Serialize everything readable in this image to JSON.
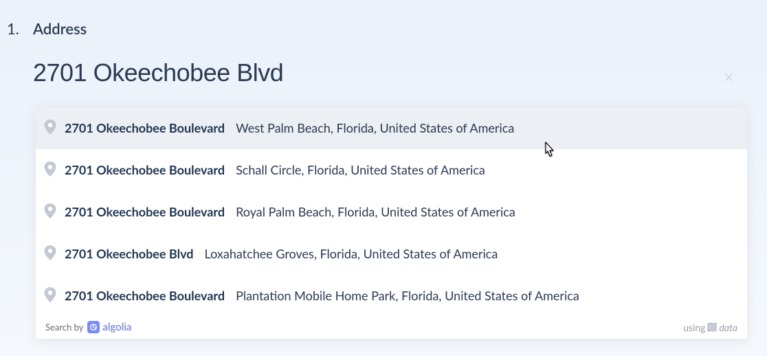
{
  "step": {
    "number": "1.",
    "label": "Address"
  },
  "search": {
    "value": "2701 Okeechobee Blvd"
  },
  "suggestions": [
    {
      "primary": "2701 Okeechobee Boulevard",
      "secondary": "West Palm Beach, Florida, United States of America",
      "highlighted": true
    },
    {
      "primary": "2701 Okeechobee Boulevard",
      "secondary": "Schall Circle, Florida, United States of America",
      "highlighted": false
    },
    {
      "primary": "2701 Okeechobee Boulevard",
      "secondary": "Royal Palm Beach, Florida, United States of America",
      "highlighted": false
    },
    {
      "primary": "2701 Okeechobee Blvd",
      "secondary": "Loxahatchee Groves, Florida, United States of America",
      "highlighted": false
    },
    {
      "primary": "2701 Okeechobee Boulevard",
      "secondary": "Plantation Mobile Home Park, Florida, United States of America",
      "highlighted": false
    }
  ],
  "footer": {
    "search_by": "Search by",
    "algolia": "algolia",
    "using": "using",
    "data": "data"
  }
}
